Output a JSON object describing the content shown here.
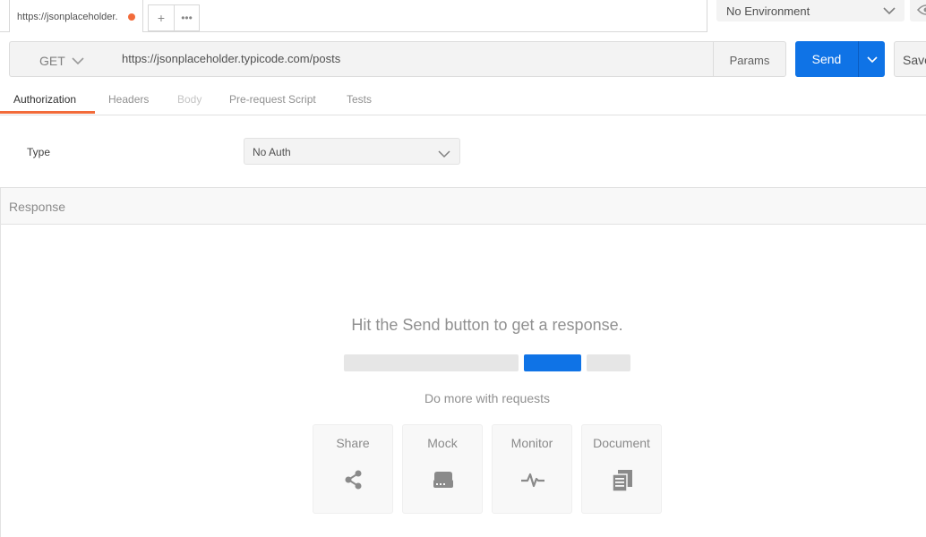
{
  "tabbar": {
    "active_tab_title": "https://jsonplaceholder.typicode.com/posts",
    "add_tab_symbol": "+",
    "more_tabs_symbol": "•••",
    "unsaved_dot_color": "#f26b3a"
  },
  "environment": {
    "selected": "No Environment"
  },
  "request": {
    "method": "GET",
    "url": "https://jsonplaceholder.typicode.com/posts",
    "params_label": "Params",
    "send_label": "Send",
    "save_label": "Save",
    "send_color": "#0f73e6"
  },
  "subtabs": [
    {
      "label": "Authorization",
      "state": "active"
    },
    {
      "label": "Headers",
      "state": "normal"
    },
    {
      "label": "Body",
      "state": "disabled"
    },
    {
      "label": "Pre-request Script",
      "state": "normal"
    },
    {
      "label": "Tests",
      "state": "normal"
    }
  ],
  "auth": {
    "type_label": "Type",
    "selected": "No Auth"
  },
  "response": {
    "header_label": "Response",
    "hint": "Hit the Send button to get a response.",
    "do_more": "Do more with requests",
    "cards": [
      {
        "label": "Share",
        "icon": "share-icon"
      },
      {
        "label": "Mock",
        "icon": "server-icon"
      },
      {
        "label": "Monitor",
        "icon": "pulse-icon"
      },
      {
        "label": "Document",
        "icon": "documents-icon"
      }
    ]
  },
  "accent_color": "#f26b3a"
}
